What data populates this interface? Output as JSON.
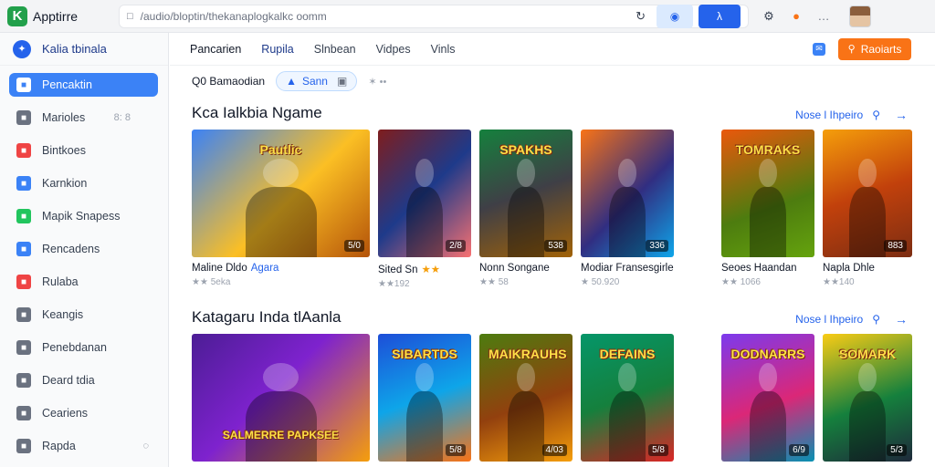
{
  "topbar": {
    "app_logo_letter": "K",
    "app_name": "Apptirre",
    "url": "/audio/bloptin/thekanaplogkalkc oomm",
    "icons": [
      "lock-icon",
      "refresh-icon",
      "extension-icon",
      "share-icon",
      "settings-icon",
      "fire-icon"
    ]
  },
  "sidebar": {
    "brand_name": "Kalia tbinala",
    "items": [
      {
        "label": "Pencaktin",
        "icon": "user-icon",
        "color": "#3b82f6",
        "active": true
      },
      {
        "label": "Marioles",
        "icon": "image-icon",
        "color": "#6b7280",
        "badge": "8: 8"
      },
      {
        "label": "Bintkoes",
        "icon": "book-icon",
        "color": "#ef4444"
      },
      {
        "label": "Karnkion",
        "icon": "cloud-icon",
        "color": "#3b82f6"
      },
      {
        "label": "Mapik Snapess",
        "icon": "puzzle-icon",
        "color": "#22c55e"
      },
      {
        "label": "Rencadens",
        "icon": "doc-icon",
        "color": "#3b82f6"
      },
      {
        "label": "Rulaba",
        "icon": "x-icon",
        "color": "#ef4444"
      },
      {
        "label": "Keangis",
        "icon": "calendar-icon",
        "color": "#6b7280"
      },
      {
        "label": "Penebdanan",
        "icon": "chart-icon",
        "color": "#6b7280"
      },
      {
        "label": "Deard tdia",
        "icon": "folder-icon",
        "color": "#6b7280"
      },
      {
        "label": "Ceariens",
        "icon": "box-icon",
        "color": "#6b7280"
      },
      {
        "label": "Rapda",
        "icon": "gear-icon",
        "color": "#6b7280",
        "extra": "◌"
      }
    ]
  },
  "tabs": [
    "Pancarien",
    "Rupila",
    "Slnbean",
    "Vidpes",
    "Vinls"
  ],
  "search_button": "Raoiarts",
  "filter": {
    "label": "Q0 Bamaodian",
    "chip": "Sann",
    "more": "✶ ••"
  },
  "sections": [
    {
      "title": "Kca Ialkbia Ngame",
      "see_all": "Nose l Ihpeiro",
      "cards": [
        {
          "title": "Maline Dldo",
          "title_hl": "Agara",
          "meta": "★★ 5eka",
          "badge": "5/0",
          "logo": "Pautlic",
          "bg": "linear-gradient(135deg,#3b82f6 0%,#fbbf24 55%,#b45309 100%)"
        },
        {
          "title": "Sited Sn",
          "stars": "★★",
          "meta": "★★192",
          "badge": "2/8",
          "logo": "",
          "bg": "linear-gradient(135deg,#7f1d1d 0%,#1e3a8a 50%,#f87171 100%)"
        },
        {
          "title": "Nonn Songane",
          "meta": "★★ 58",
          "badge": "538",
          "logo": "SPAKHS",
          "bg": "linear-gradient(160deg,#15803d 0%,#3f3f46 50%,#a16207 100%)"
        },
        {
          "title": "Modiar Fransesgirle",
          "meta": "★ 50.920",
          "badge": "336",
          "logo": "",
          "bg": "linear-gradient(135deg,#f97316 0%,#312e81 55%,#0ea5e9 100%)"
        },
        {
          "title": "Seoes Haandan",
          "meta": "★★ 1066",
          "badge": "",
          "logo": "TOMRAKS",
          "bg": "linear-gradient(160deg,#ea580c 0%,#4d7c0f 60%,#65a30d 100%)"
        },
        {
          "title": "Napla Dhle",
          "meta": "★★140",
          "badge": "883",
          "logo": "",
          "bg": "linear-gradient(160deg,#f59e0b 0%,#c2410c 50%,#7c2d12 100%)"
        }
      ]
    },
    {
      "title": "Katagaru Inda tlAanla",
      "see_all": "Nose l Ihpeiro",
      "cards": [
        {
          "badge": "",
          "logo": "SALMERRE PAPKSEE",
          "bg": "linear-gradient(135deg,#4c1d95 0%,#7e22ce 45%,#f59e0b 100%)"
        },
        {
          "badge": "5/8",
          "logo": "SIBARTDS",
          "bg": "linear-gradient(160deg,#1d4ed8 0%,#0ea5e9 50%,#f97316 100%)"
        },
        {
          "badge": "4/03",
          "logo": "MAIKRAUHS",
          "bg": "linear-gradient(160deg,#4d7c0f 0%,#92400e 55%,#f59e0b 100%)"
        },
        {
          "badge": "5/8",
          "logo": "DEFAINS",
          "bg": "linear-gradient(160deg,#059669 0%,#15803d 50%,#dc2626 100%)"
        },
        {
          "badge": "6/9",
          "logo": "DODNARRS",
          "bg": "linear-gradient(160deg,#7c3aed 0%,#db2777 55%,#0891b2 100%)"
        },
        {
          "badge": "5/3",
          "logo": "SOMARK",
          "bg": "linear-gradient(160deg,#facc15 0%,#15803d 55%,#1e293b 100%)"
        }
      ]
    }
  ]
}
